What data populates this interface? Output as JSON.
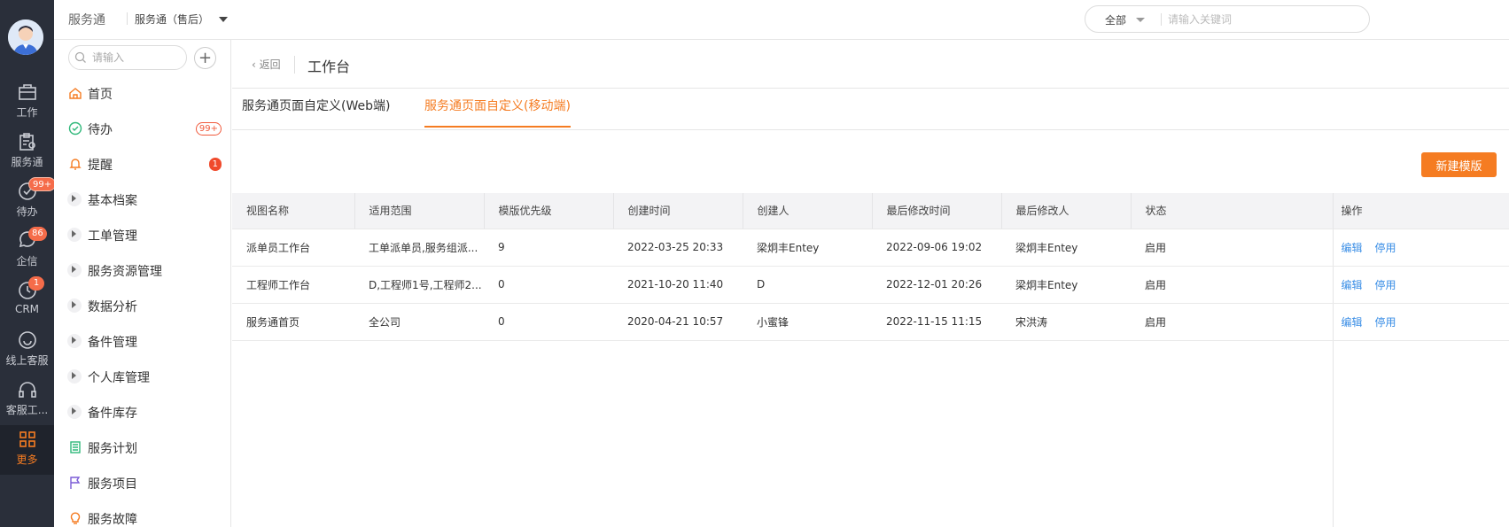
{
  "rail": {
    "items": [
      {
        "label": "工作",
        "icon": "briefcase-icon"
      },
      {
        "label": "服务通",
        "icon": "clipboard-icon"
      },
      {
        "label": "待办",
        "icon": "check-circle-icon",
        "badge": "99+"
      },
      {
        "label": "企信",
        "icon": "chat-bubble-icon",
        "badge": "86"
      },
      {
        "label": "CRM",
        "icon": "clock-icon",
        "badge": "1"
      },
      {
        "label": "线上客服",
        "icon": "smile-icon"
      },
      {
        "label": "客服工...",
        "icon": "headset-icon"
      },
      {
        "label": "更多",
        "icon": "grid-icon"
      }
    ]
  },
  "topbar": {
    "app_name": "服务通",
    "app_select": "服务通（售后）",
    "search_scope": "全部",
    "search_placeholder": "请输入关键词"
  },
  "subnav": {
    "search_placeholder": "请输入",
    "add_label": "+",
    "items": [
      {
        "label": "首页",
        "icon": "home-icon"
      },
      {
        "label": "待办",
        "icon": "check-circle-icon",
        "badge": "99+"
      },
      {
        "label": "提醒",
        "icon": "bell-icon",
        "badge": "1"
      },
      {
        "label": "基本档案",
        "icon": "expand-arrow-icon"
      },
      {
        "label": "工单管理",
        "icon": "expand-arrow-icon"
      },
      {
        "label": "服务资源管理",
        "icon": "expand-arrow-icon"
      },
      {
        "label": "数据分析",
        "icon": "expand-arrow-icon"
      },
      {
        "label": "备件管理",
        "icon": "expand-arrow-icon"
      },
      {
        "label": "个人库管理",
        "icon": "expand-arrow-icon"
      },
      {
        "label": "备件库存",
        "icon": "expand-arrow-icon"
      },
      {
        "label": "服务计划",
        "icon": "list-icon"
      },
      {
        "label": "服务项目",
        "icon": "flag-icon"
      },
      {
        "label": "服务故障",
        "icon": "bulb-icon"
      }
    ]
  },
  "main": {
    "back_label": "返回",
    "title": "工作台",
    "tabs": [
      {
        "label": "服务通页面自定义(Web端)",
        "active": false
      },
      {
        "label": "服务通页面自定义(移动端)",
        "active": true
      }
    ],
    "new_button": "新建模版",
    "table": {
      "headers": [
        "视图名称",
        "适用范围",
        "模版优先级",
        "创建时间",
        "创建人",
        "最后修改时间",
        "最后修改人",
        "状态",
        "操作"
      ],
      "rows": [
        [
          "派单员工作台",
          "工单派单员,服务组派...",
          "9",
          "2022-03-25 20:33",
          "梁炯丰Entey",
          "2022-09-06 19:02",
          "梁炯丰Entey",
          "启用"
        ],
        [
          "工程师工作台",
          "D,工程师1号,工程师2...",
          "0",
          "2021-10-20 11:40",
          "D",
          "2022-12-01 20:26",
          "梁炯丰Entey",
          "启用"
        ],
        [
          "服务通首页",
          "全公司",
          "0",
          "2020-04-21 10:57",
          "小蜜锋",
          "2022-11-15 11:15",
          "宋洪涛",
          "启用"
        ]
      ],
      "actions": [
        "编辑",
        "停用"
      ]
    }
  },
  "colors": {
    "accent": "#f57c22",
    "link": "#3a8ee6",
    "rail_bg": "#2a2f3a",
    "badge": "#f56c4a"
  }
}
